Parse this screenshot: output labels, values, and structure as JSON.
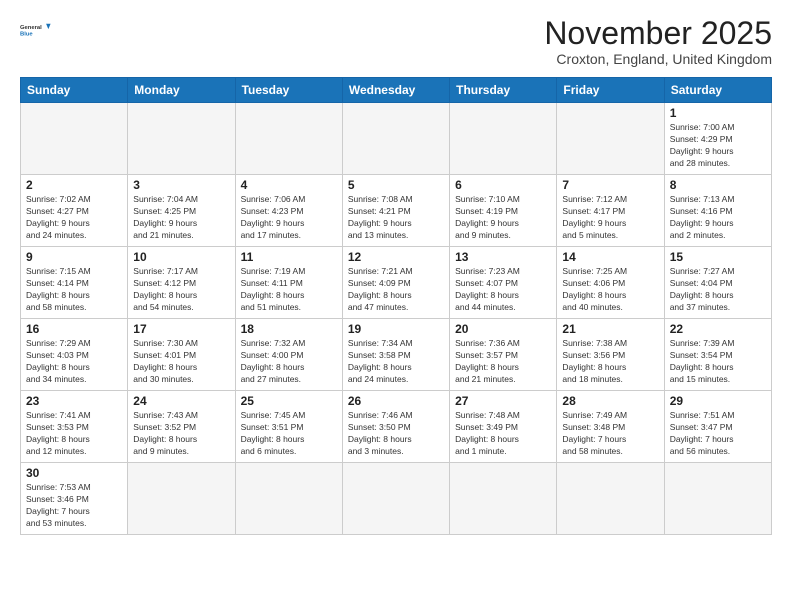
{
  "logo": {
    "line1": "General",
    "line2": "Blue"
  },
  "title": "November 2025",
  "subtitle": "Croxton, England, United Kingdom",
  "weekdays": [
    "Sunday",
    "Monday",
    "Tuesday",
    "Wednesday",
    "Thursday",
    "Friday",
    "Saturday"
  ],
  "weeks": [
    [
      {
        "day": null,
        "info": null
      },
      {
        "day": null,
        "info": null
      },
      {
        "day": null,
        "info": null
      },
      {
        "day": null,
        "info": null
      },
      {
        "day": null,
        "info": null
      },
      {
        "day": null,
        "info": null
      },
      {
        "day": "1",
        "info": "Sunrise: 7:00 AM\nSunset: 4:29 PM\nDaylight: 9 hours\nand 28 minutes."
      }
    ],
    [
      {
        "day": "2",
        "info": "Sunrise: 7:02 AM\nSunset: 4:27 PM\nDaylight: 9 hours\nand 24 minutes."
      },
      {
        "day": "3",
        "info": "Sunrise: 7:04 AM\nSunset: 4:25 PM\nDaylight: 9 hours\nand 21 minutes."
      },
      {
        "day": "4",
        "info": "Sunrise: 7:06 AM\nSunset: 4:23 PM\nDaylight: 9 hours\nand 17 minutes."
      },
      {
        "day": "5",
        "info": "Sunrise: 7:08 AM\nSunset: 4:21 PM\nDaylight: 9 hours\nand 13 minutes."
      },
      {
        "day": "6",
        "info": "Sunrise: 7:10 AM\nSunset: 4:19 PM\nDaylight: 9 hours\nand 9 minutes."
      },
      {
        "day": "7",
        "info": "Sunrise: 7:12 AM\nSunset: 4:17 PM\nDaylight: 9 hours\nand 5 minutes."
      },
      {
        "day": "8",
        "info": "Sunrise: 7:13 AM\nSunset: 4:16 PM\nDaylight: 9 hours\nand 2 minutes."
      }
    ],
    [
      {
        "day": "9",
        "info": "Sunrise: 7:15 AM\nSunset: 4:14 PM\nDaylight: 8 hours\nand 58 minutes."
      },
      {
        "day": "10",
        "info": "Sunrise: 7:17 AM\nSunset: 4:12 PM\nDaylight: 8 hours\nand 54 minutes."
      },
      {
        "day": "11",
        "info": "Sunrise: 7:19 AM\nSunset: 4:11 PM\nDaylight: 8 hours\nand 51 minutes."
      },
      {
        "day": "12",
        "info": "Sunrise: 7:21 AM\nSunset: 4:09 PM\nDaylight: 8 hours\nand 47 minutes."
      },
      {
        "day": "13",
        "info": "Sunrise: 7:23 AM\nSunset: 4:07 PM\nDaylight: 8 hours\nand 44 minutes."
      },
      {
        "day": "14",
        "info": "Sunrise: 7:25 AM\nSunset: 4:06 PM\nDaylight: 8 hours\nand 40 minutes."
      },
      {
        "day": "15",
        "info": "Sunrise: 7:27 AM\nSunset: 4:04 PM\nDaylight: 8 hours\nand 37 minutes."
      }
    ],
    [
      {
        "day": "16",
        "info": "Sunrise: 7:29 AM\nSunset: 4:03 PM\nDaylight: 8 hours\nand 34 minutes."
      },
      {
        "day": "17",
        "info": "Sunrise: 7:30 AM\nSunset: 4:01 PM\nDaylight: 8 hours\nand 30 minutes."
      },
      {
        "day": "18",
        "info": "Sunrise: 7:32 AM\nSunset: 4:00 PM\nDaylight: 8 hours\nand 27 minutes."
      },
      {
        "day": "19",
        "info": "Sunrise: 7:34 AM\nSunset: 3:58 PM\nDaylight: 8 hours\nand 24 minutes."
      },
      {
        "day": "20",
        "info": "Sunrise: 7:36 AM\nSunset: 3:57 PM\nDaylight: 8 hours\nand 21 minutes."
      },
      {
        "day": "21",
        "info": "Sunrise: 7:38 AM\nSunset: 3:56 PM\nDaylight: 8 hours\nand 18 minutes."
      },
      {
        "day": "22",
        "info": "Sunrise: 7:39 AM\nSunset: 3:54 PM\nDaylight: 8 hours\nand 15 minutes."
      }
    ],
    [
      {
        "day": "23",
        "info": "Sunrise: 7:41 AM\nSunset: 3:53 PM\nDaylight: 8 hours\nand 12 minutes."
      },
      {
        "day": "24",
        "info": "Sunrise: 7:43 AM\nSunset: 3:52 PM\nDaylight: 8 hours\nand 9 minutes."
      },
      {
        "day": "25",
        "info": "Sunrise: 7:45 AM\nSunset: 3:51 PM\nDaylight: 8 hours\nand 6 minutes."
      },
      {
        "day": "26",
        "info": "Sunrise: 7:46 AM\nSunset: 3:50 PM\nDaylight: 8 hours\nand 3 minutes."
      },
      {
        "day": "27",
        "info": "Sunrise: 7:48 AM\nSunset: 3:49 PM\nDaylight: 8 hours\nand 1 minute."
      },
      {
        "day": "28",
        "info": "Sunrise: 7:49 AM\nSunset: 3:48 PM\nDaylight: 7 hours\nand 58 minutes."
      },
      {
        "day": "29",
        "info": "Sunrise: 7:51 AM\nSunset: 3:47 PM\nDaylight: 7 hours\nand 56 minutes."
      }
    ],
    [
      {
        "day": "30",
        "info": "Sunrise: 7:53 AM\nSunset: 3:46 PM\nDaylight: 7 hours\nand 53 minutes."
      },
      {
        "day": null,
        "info": null
      },
      {
        "day": null,
        "info": null
      },
      {
        "day": null,
        "info": null
      },
      {
        "day": null,
        "info": null
      },
      {
        "day": null,
        "info": null
      },
      {
        "day": null,
        "info": null
      }
    ]
  ]
}
